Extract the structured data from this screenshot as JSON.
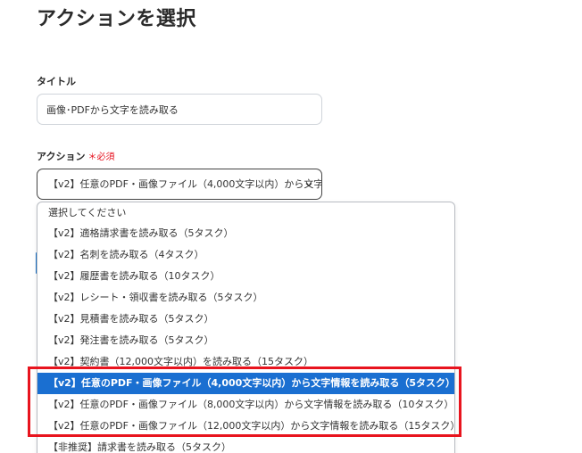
{
  "page": {
    "title": "アクションを選択"
  },
  "title_field": {
    "label": "タイトル",
    "value": "画像･PDFから文字を読み取る"
  },
  "action_field": {
    "label": "アクション",
    "required_mark": "＊",
    "required_text": "必須",
    "value": "【v2】任意のPDF・画像ファイル（4,000文字以内）から文字情報を読み取る（5タスク）"
  },
  "dropdown": {
    "options": [
      "選択してください",
      "【v2】適格請求書を読み取る（5タスク）",
      "【v2】名刺を読み取る（4タスク）",
      "【v2】履歴書を読み取る（10タスク）",
      "【v2】レシート・領収書を読み取る（5タスク）",
      "【v2】見積書を読み取る（5タスク）",
      "【v2】発注書を読み取る（5タスク）",
      "【v2】契約書（12,000文字以内）を読み取る（15タスク）",
      "【v2】任意のPDF・画像ファイル（4,000文字以内）から文字情報を読み取る（5タスク）",
      "【v2】任意のPDF・画像ファイル（8,000文字以内）から文字情報を読み取る（10タスク）",
      "【v2】任意のPDF・画像ファイル（12,000文字以内）から文字情報を読み取る（15タスク）",
      "【非推奨】請求書を読み取る（5タスク）"
    ],
    "selected_index": 8
  },
  "colors": {
    "selected_bg": "#1a6fd1",
    "highlight_border": "#e8141e",
    "required": "#e60f1c"
  },
  "icons": {
    "select_indicator": "chevron-down-icon"
  }
}
